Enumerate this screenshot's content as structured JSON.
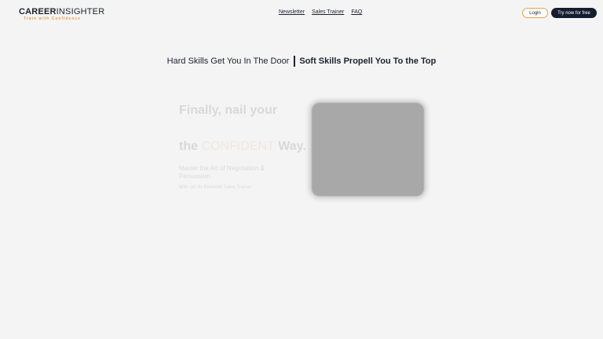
{
  "header": {
    "logo": {
      "bold": "CAREER",
      "light": "INSIGHTER",
      "tagline": "Train with Confidence"
    },
    "nav": [
      {
        "label": "Newsletter"
      },
      {
        "label": "Sales Trainer"
      },
      {
        "label": "FAQ"
      }
    ],
    "login_label": "Login",
    "try_label": "Try now for free"
  },
  "headline": {
    "part1": "Hard Skills Get You In The Door",
    "part2": "Soft Skills Propell You To the Top"
  },
  "hero": {
    "line1": "Finally, nail your",
    "line2_prefix": "the ",
    "line2_accent": "CONFIDENT",
    "line2_suffix": " Way.",
    "subtitle": "Master the Art of Negotiation & Persuasion",
    "small": "With our AI-Powered Sales Trainer"
  },
  "colors": {
    "accent": "#e8a14a",
    "navy": "#141c2e",
    "background": "#f4f4f4"
  }
}
